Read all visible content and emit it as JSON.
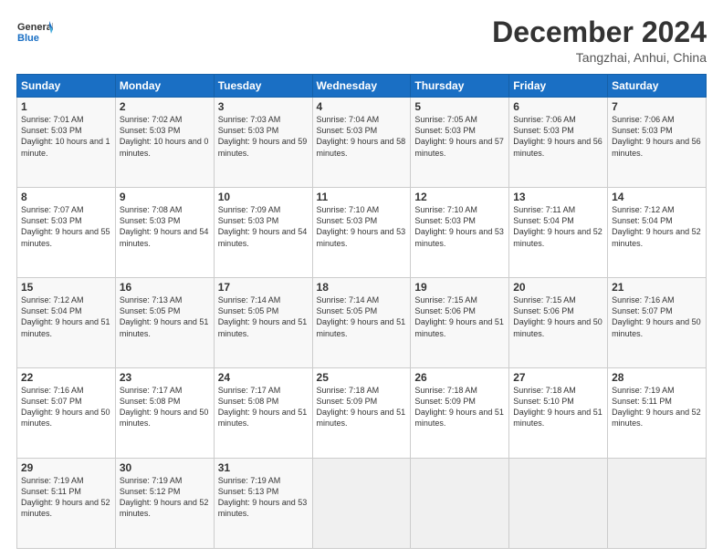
{
  "logo": {
    "line1": "General",
    "line2": "Blue"
  },
  "title": "December 2024",
  "subtitle": "Tangzhai, Anhui, China",
  "header_days": [
    "Sunday",
    "Monday",
    "Tuesday",
    "Wednesday",
    "Thursday",
    "Friday",
    "Saturday"
  ],
  "weeks": [
    [
      {
        "day": 1,
        "sunrise": "7:01 AM",
        "sunset": "5:03 PM",
        "daylight": "10 hours and 1 minute."
      },
      {
        "day": 2,
        "sunrise": "7:02 AM",
        "sunset": "5:03 PM",
        "daylight": "10 hours and 0 minutes."
      },
      {
        "day": 3,
        "sunrise": "7:03 AM",
        "sunset": "5:03 PM",
        "daylight": "9 hours and 59 minutes."
      },
      {
        "day": 4,
        "sunrise": "7:04 AM",
        "sunset": "5:03 PM",
        "daylight": "9 hours and 58 minutes."
      },
      {
        "day": 5,
        "sunrise": "7:05 AM",
        "sunset": "5:03 PM",
        "daylight": "9 hours and 57 minutes."
      },
      {
        "day": 6,
        "sunrise": "7:06 AM",
        "sunset": "5:03 PM",
        "daylight": "9 hours and 56 minutes."
      },
      {
        "day": 7,
        "sunrise": "7:06 AM",
        "sunset": "5:03 PM",
        "daylight": "9 hours and 56 minutes."
      }
    ],
    [
      {
        "day": 8,
        "sunrise": "7:07 AM",
        "sunset": "5:03 PM",
        "daylight": "9 hours and 55 minutes."
      },
      {
        "day": 9,
        "sunrise": "7:08 AM",
        "sunset": "5:03 PM",
        "daylight": "9 hours and 54 minutes."
      },
      {
        "day": 10,
        "sunrise": "7:09 AM",
        "sunset": "5:03 PM",
        "daylight": "9 hours and 54 minutes."
      },
      {
        "day": 11,
        "sunrise": "7:10 AM",
        "sunset": "5:03 PM",
        "daylight": "9 hours and 53 minutes."
      },
      {
        "day": 12,
        "sunrise": "7:10 AM",
        "sunset": "5:03 PM",
        "daylight": "9 hours and 53 minutes."
      },
      {
        "day": 13,
        "sunrise": "7:11 AM",
        "sunset": "5:04 PM",
        "daylight": "9 hours and 52 minutes."
      },
      {
        "day": 14,
        "sunrise": "7:12 AM",
        "sunset": "5:04 PM",
        "daylight": "9 hours and 52 minutes."
      }
    ],
    [
      {
        "day": 15,
        "sunrise": "7:12 AM",
        "sunset": "5:04 PM",
        "daylight": "9 hours and 51 minutes."
      },
      {
        "day": 16,
        "sunrise": "7:13 AM",
        "sunset": "5:05 PM",
        "daylight": "9 hours and 51 minutes."
      },
      {
        "day": 17,
        "sunrise": "7:14 AM",
        "sunset": "5:05 PM",
        "daylight": "9 hours and 51 minutes."
      },
      {
        "day": 18,
        "sunrise": "7:14 AM",
        "sunset": "5:05 PM",
        "daylight": "9 hours and 51 minutes."
      },
      {
        "day": 19,
        "sunrise": "7:15 AM",
        "sunset": "5:06 PM",
        "daylight": "9 hours and 51 minutes."
      },
      {
        "day": 20,
        "sunrise": "7:15 AM",
        "sunset": "5:06 PM",
        "daylight": "9 hours and 50 minutes."
      },
      {
        "day": 21,
        "sunrise": "7:16 AM",
        "sunset": "5:07 PM",
        "daylight": "9 hours and 50 minutes."
      }
    ],
    [
      {
        "day": 22,
        "sunrise": "7:16 AM",
        "sunset": "5:07 PM",
        "daylight": "9 hours and 50 minutes."
      },
      {
        "day": 23,
        "sunrise": "7:17 AM",
        "sunset": "5:08 PM",
        "daylight": "9 hours and 50 minutes."
      },
      {
        "day": 24,
        "sunrise": "7:17 AM",
        "sunset": "5:08 PM",
        "daylight": "9 hours and 51 minutes."
      },
      {
        "day": 25,
        "sunrise": "7:18 AM",
        "sunset": "5:09 PM",
        "daylight": "9 hours and 51 minutes."
      },
      {
        "day": 26,
        "sunrise": "7:18 AM",
        "sunset": "5:09 PM",
        "daylight": "9 hours and 51 minutes."
      },
      {
        "day": 27,
        "sunrise": "7:18 AM",
        "sunset": "5:10 PM",
        "daylight": "9 hours and 51 minutes."
      },
      {
        "day": 28,
        "sunrise": "7:19 AM",
        "sunset": "5:11 PM",
        "daylight": "9 hours and 52 minutes."
      }
    ],
    [
      {
        "day": 29,
        "sunrise": "7:19 AM",
        "sunset": "5:11 PM",
        "daylight": "9 hours and 52 minutes."
      },
      {
        "day": 30,
        "sunrise": "7:19 AM",
        "sunset": "5:12 PM",
        "daylight": "9 hours and 52 minutes."
      },
      {
        "day": 31,
        "sunrise": "7:19 AM",
        "sunset": "5:13 PM",
        "daylight": "9 hours and 53 minutes."
      },
      null,
      null,
      null,
      null
    ]
  ]
}
